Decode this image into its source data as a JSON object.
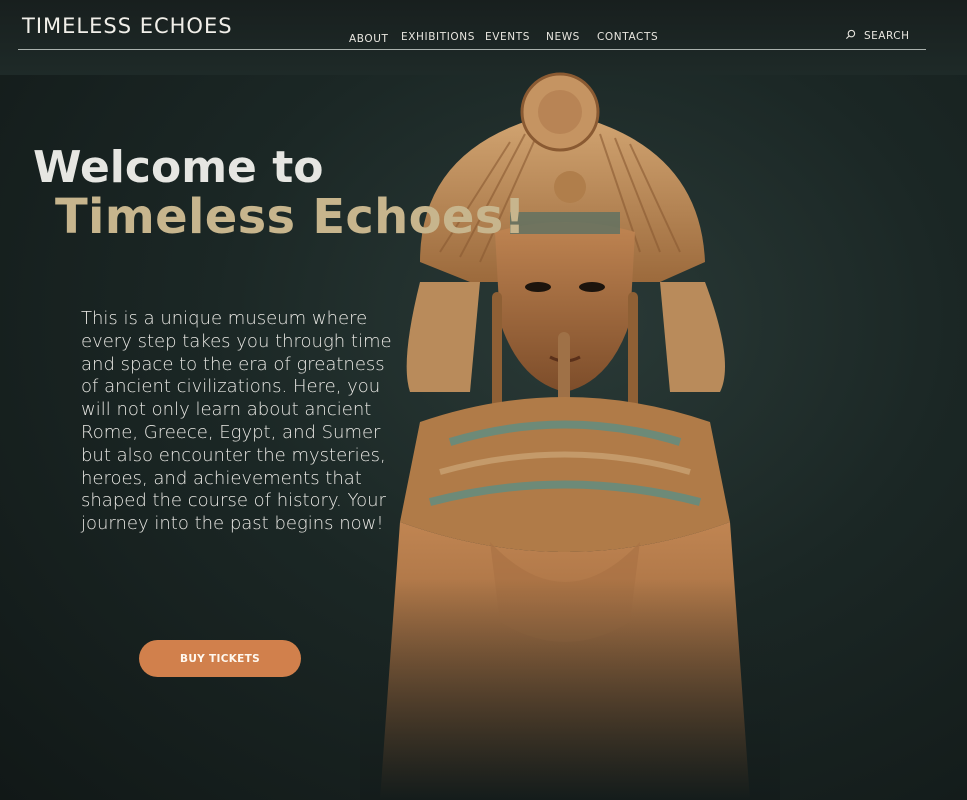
{
  "header": {
    "brand": "TIMELESS ECHOES",
    "nav": [
      {
        "label": "ABOUT"
      },
      {
        "label": "EXHIBITIONS"
      },
      {
        "label": "EVENTS"
      },
      {
        "label": "NEWS"
      },
      {
        "label": "CONTACTS"
      }
    ],
    "search_label": "SEARCH"
  },
  "hero": {
    "welcome": "Welcome to",
    "title": "Timeless Echoes!",
    "intro": "This is a unique museum where every step takes you through time and space to the era of greatness of ancient civilizations. Here, you will not only learn about ancient Rome, Greece, Egypt, and Sumer but also encounter the mysteries, heroes, and achievements that shaped the course of history. Your journey into the past begins now!",
    "cta": "BUY TICKETS",
    "image": "egyptian-pharaoh-statue"
  },
  "colors": {
    "background": "#1b2725",
    "accent": "#c7b58d",
    "button": "#d1804c",
    "text": "#e9e8e4"
  },
  "icons": {
    "search": "search-icon"
  }
}
